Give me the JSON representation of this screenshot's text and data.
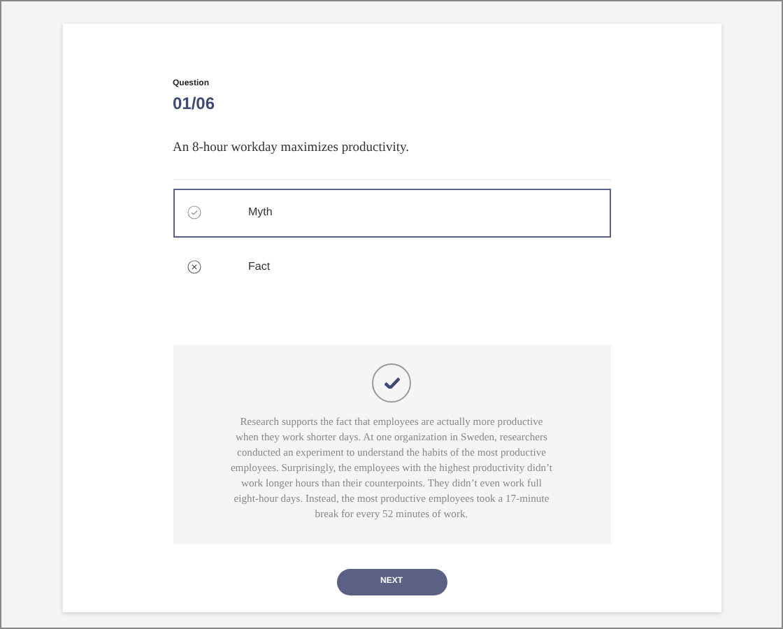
{
  "question": {
    "label": "Question",
    "number": "01/06",
    "text": "An 8-hour workday maximizes productivity."
  },
  "options": [
    {
      "label": "Myth",
      "kind": "check",
      "selected": true
    },
    {
      "label": "Fact",
      "kind": "cross",
      "selected": false
    }
  ],
  "explanation": {
    "kind": "check",
    "text": "Research supports the fact that employees are actually more productive when they work shorter days. At one organization in Sweden, researchers conducted an experiment to understand the habits of the most productive employees. Surprisingly, the employees with the highest productivity didn’t work longer hours than their counterpoints. They didn’t even work full eight-hour days. Instead, the most productive employees took a 17-minute break for every 52 minutes of work."
  },
  "next_button": "NEXT"
}
